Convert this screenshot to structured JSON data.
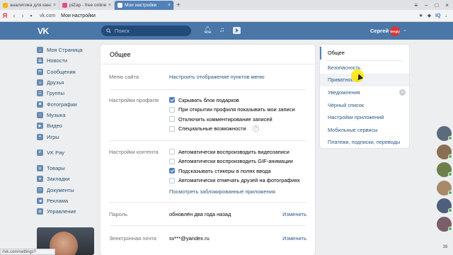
{
  "browser": {
    "tabs": [
      {
        "title": "аналитика для канала - Тв",
        "icon_color": "#f2b600"
      },
      {
        "title": "piZap - free online photo ...",
        "icon_color": "#e84a8a"
      },
      {
        "title": "Мои настройки",
        "icon_color": "#4a76a8"
      }
    ],
    "url": "vk.com",
    "page_title": "Мои настройки",
    "yandex_logo": "Я",
    "right_tools": [
      "IQ"
    ],
    "status_url": "//vk.com/settings?act=privacy"
  },
  "header": {
    "logo": "VK",
    "search_placeholder": "Поиск",
    "user_name": "Сергей",
    "avatar_text": "Sergiy",
    "accent": "#4a76a8"
  },
  "leftnav": {
    "group1": [
      "Моя Страница",
      "Новости",
      "Сообщения",
      "Друзья",
      "Группы",
      "Фотографии",
      "Музыка",
      "Видео",
      "Игры"
    ],
    "group2": [
      "VK Pay"
    ],
    "group3": [
      "Товары",
      "Закладки",
      "Документы",
      "Реклама",
      "Управление"
    ]
  },
  "main": {
    "title": "Общее",
    "site_menu": {
      "label": "Меню сайта",
      "link": "Настроить отображение пунктов меню"
    },
    "profile": {
      "label": "Настройки профиля",
      "options": [
        {
          "text": "Скрывать блок подарков",
          "checked": true
        },
        {
          "text": "При открытии профиля показывать мои записи",
          "checked": false
        },
        {
          "text": "Отключить комментирование записей",
          "checked": false
        },
        {
          "text": "Специальные возможности",
          "checked": false
        }
      ],
      "help": "?"
    },
    "content": {
      "label": "Настройки контента",
      "options": [
        {
          "text": "Автоматически воспроизводить видеозаписи",
          "checked": false
        },
        {
          "text": "Автоматически воспроизводить GIF-анимации",
          "checked": false
        },
        {
          "text": "Подсказывать стикеры в полях ввода",
          "checked": true
        },
        {
          "text": "Автоматически отмечать друзей на фотографиях",
          "checked": false
        }
      ],
      "link": "Посмотреть заблокированные приложения"
    },
    "password": {
      "label": "Пароль",
      "value": "обновлён два года назад",
      "action": "Изменить"
    },
    "email": {
      "label": "Электронная почта",
      "value": "sv***@yandex.ru",
      "action": "Изменить"
    }
  },
  "rightmenu": {
    "items": [
      "Общее",
      "Безопасность",
      "Приватность",
      "Уведомления",
      "Чёрный список",
      "Настройки приложений",
      "Мобильные сервисы",
      "Платежи, подписки, переводы"
    ],
    "active_index": 0,
    "hover_index": 2
  },
  "chats": {
    "avatars": [
      "#5a6b7d",
      "#8b6f52",
      "#6f7f4a",
      "#a88a6a",
      "#4d5f7a",
      "#7a5e6b"
    ],
    "badge": "38"
  }
}
